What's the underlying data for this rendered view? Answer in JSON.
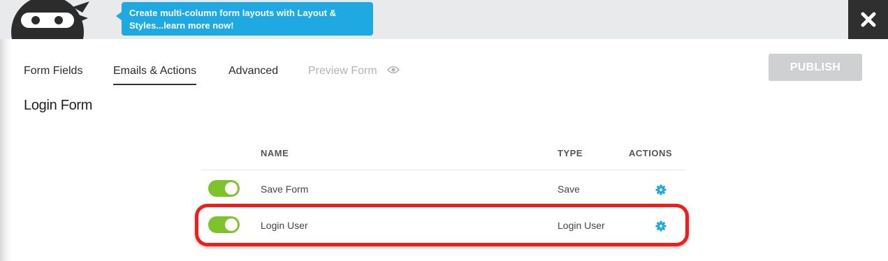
{
  "banner": {
    "tip_text": "Create multi-column form layouts with Layout & Styles...learn more now!",
    "logo_icon": "ninja-logo-icon",
    "close_icon": "close-icon"
  },
  "tabs": [
    {
      "label": "Form Fields",
      "state": "normal"
    },
    {
      "label": "Emails & Actions",
      "state": "active"
    },
    {
      "label": "Advanced",
      "state": "normal"
    },
    {
      "label": "Preview Form",
      "state": "disabled",
      "icon": "eye-icon"
    }
  ],
  "publish_label": "PUBLISH",
  "form_title": "Login Form",
  "table": {
    "headers": {
      "name": "NAME",
      "type": "TYPE",
      "actions": "ACTIONS"
    },
    "rows": [
      {
        "enabled": true,
        "name": "Save Form",
        "type": "Save",
        "action_icon": "gear-icon"
      },
      {
        "enabled": true,
        "name": "Login User",
        "type": "Login User",
        "action_icon": "gear-icon"
      }
    ]
  },
  "colors": {
    "accent_blue": "#1ea9e2",
    "toggle_green": "#7dc32c",
    "highlight_red": "#f11c1c",
    "publish_disabled": "#cfd0d2"
  }
}
